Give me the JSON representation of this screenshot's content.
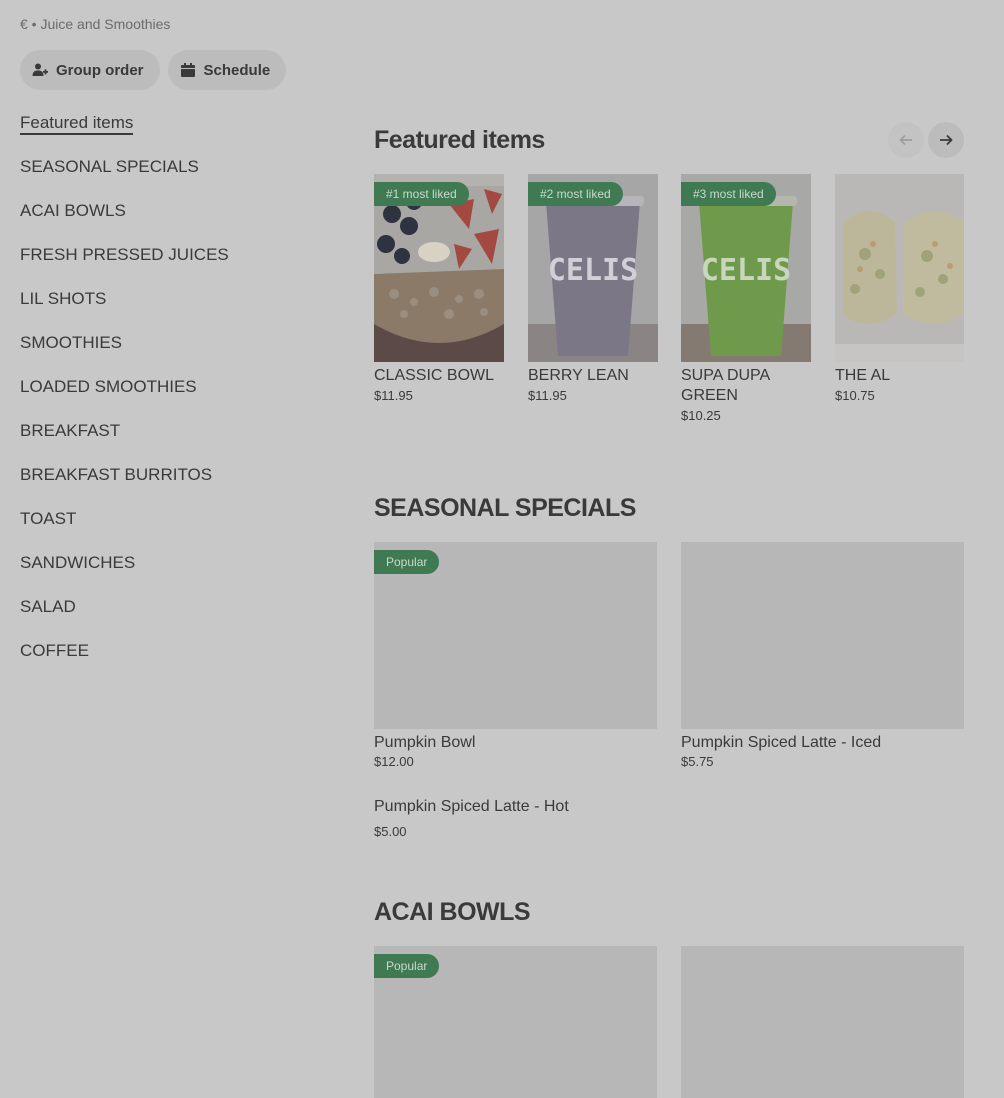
{
  "header": {
    "breadcrumb": "€ • Juice and Smoothies",
    "group_order_label": "Group order",
    "schedule_label": "Schedule"
  },
  "sidebar": {
    "items": [
      {
        "label": "Featured items"
      },
      {
        "label": "SEASONAL SPECIALS"
      },
      {
        "label": "ACAI BOWLS"
      },
      {
        "label": "FRESH PRESSED JUICES"
      },
      {
        "label": "LIL SHOTS"
      },
      {
        "label": "SMOOTHIES"
      },
      {
        "label": "LOADED SMOOTHIES"
      },
      {
        "label": "BREAKFAST"
      },
      {
        "label": "BREAKFAST BURRITOS"
      },
      {
        "label": "TOAST"
      },
      {
        "label": "SANDWICHES"
      },
      {
        "label": "SALAD"
      },
      {
        "label": "COFFEE"
      }
    ]
  },
  "featured": {
    "title": "Featured items",
    "items": [
      {
        "badge": "#1 most liked",
        "name": "CLASSIC BOWL",
        "price": "$11.95",
        "image": "acai-bowl"
      },
      {
        "badge": "#2 most liked",
        "name": "BERRY LEAN",
        "price": "$11.95",
        "image": "purple-smoothie"
      },
      {
        "badge": "#3 most liked",
        "name": "SUPA DUPA GREEN",
        "price": "$10.25",
        "image": "green-smoothie"
      },
      {
        "badge": "",
        "name": "THE AL",
        "price": "$10.75",
        "image": "burrito"
      }
    ]
  },
  "seasonal": {
    "title": "SEASONAL SPECIALS",
    "items": [
      {
        "badge": "Popular",
        "name": "Pumpkin Bowl",
        "price": "$12.00"
      },
      {
        "badge": "",
        "name": "Pumpkin Spiced Latte - Iced",
        "price": "$5.75"
      },
      {
        "badge": "",
        "name": "Pumpkin Spiced Latte - Hot",
        "price": "$5.00"
      }
    ]
  },
  "acai": {
    "title": "ACAI BOWLS",
    "items": [
      {
        "badge": "Popular"
      },
      {
        "badge": ""
      }
    ]
  },
  "brand": {
    "cup_text": "CELIS",
    "badge_color": "#3f7a53"
  }
}
